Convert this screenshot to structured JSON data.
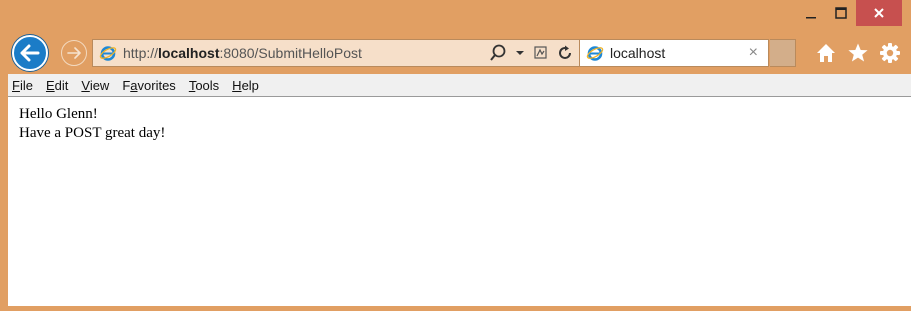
{
  "browser": {
    "caption": {
      "minimize_icon": "minimize-icon",
      "maximize_icon": "maximize-icon",
      "close_icon": "close-icon",
      "close_color": "#c7504f"
    },
    "frame_color": "#e19f63",
    "address": {
      "url_prefix": "http://",
      "url_host": "localhost",
      "url_rest": ":8080/SubmitHelloPost"
    },
    "tab": {
      "title": "localhost",
      "close": "×"
    }
  },
  "menu": {
    "items": [
      {
        "mnemonic": "F",
        "rest": "ile"
      },
      {
        "mnemonic": "E",
        "rest": "dit"
      },
      {
        "mnemonic": "V",
        "rest": "iew"
      },
      {
        "pre": "F",
        "mnemonic": "a",
        "rest": "vorites"
      },
      {
        "mnemonic": "T",
        "rest": "ools"
      },
      {
        "mnemonic": "H",
        "rest": "elp"
      }
    ]
  },
  "page": {
    "line1": "Hello Glenn!",
    "line2": "Have a POST great day!"
  }
}
